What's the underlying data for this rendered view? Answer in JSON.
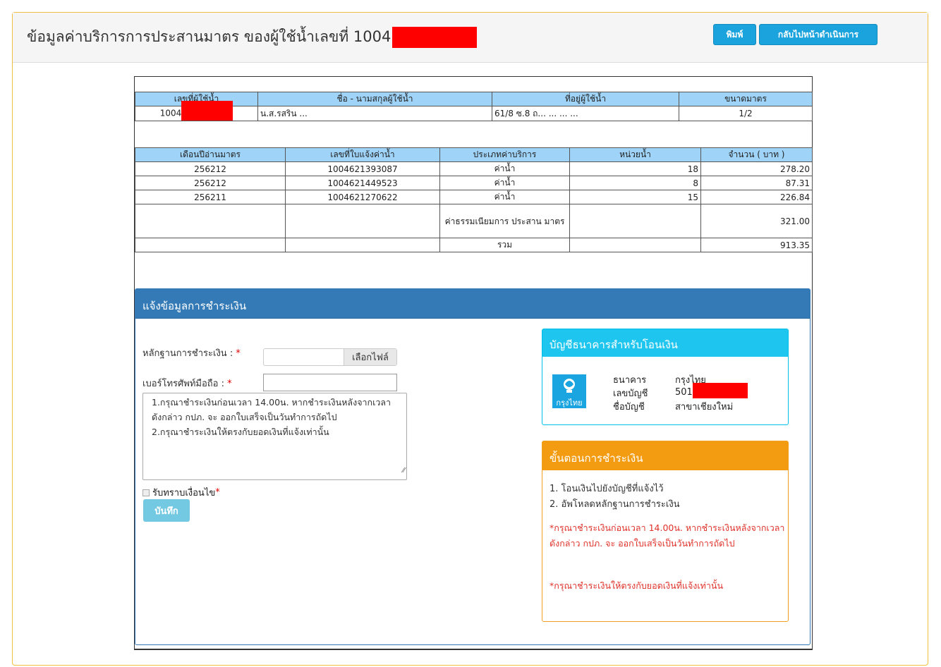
{
  "header": {
    "title": "ข้อมูลค่าบริการการประสานมาตร ของผู้ใช้น้ำเลขที่ 1004",
    "print_label": "พิมพ์",
    "back_label": "กลับไปหน้าดำเนินการ"
  },
  "customer_table": {
    "headers": [
      "เลขที่ผู้ใช้น้ำ",
      "ชื่อ - นามสกุลผู้ใช้น้ำ",
      "ที่อยู่ผู้ใช้น้ำ",
      "ขนาดมาตร"
    ],
    "row": [
      "1004",
      "น.ส.รสริน ...",
      "61/8 ซ.8 ถ... ... ... ...",
      "1/2"
    ]
  },
  "bill_table": {
    "headers": [
      "เดือนปีอ่านมาตร",
      "เลขที่ใบแจ้งค่าน้ำ",
      "ประเภทค่าบริการ",
      "หน่วยน้ำ",
      "จำนวน ( บาท )"
    ],
    "rows": [
      [
        "256212",
        "1004621393087",
        "ค่าน้ำ",
        "18",
        "278.20"
      ],
      [
        "256212",
        "1004621449523",
        "ค่าน้ำ",
        "8",
        "87.31"
      ],
      [
        "256211",
        "1004621270622",
        "ค่าน้ำ",
        "15",
        "226.84"
      ]
    ],
    "fee_label": "ค่าธรรมเนียมการ ประสาน มาตร",
    "fee_amount": "321.00",
    "total_label": "รวม",
    "total_amount": "913.35"
  },
  "payment": {
    "heading": "แจ้งข้อมูลการชำระเงิน",
    "proof_label": "หลักฐานการชำระเงิน : ",
    "file_button": "เลือกไฟล์",
    "phone_label": "เบอร์โทรศัพท์มือถือ : ",
    "required_mark": "*",
    "terms_line1": "1.กรุณาชำระเงินก่อนเวลา 14.00น. หากชำระเงินหลังจากเวลาดังกล่าว กปภ. จะ ออกใบเสร็จเป็นวันทำการถัดไป",
    "terms_line2": "2.กรุณาชำระเงินให้ตรงกับยอดเงินที่แจ้งเท่านั้น",
    "accept_label": "รับทราบเงื่อนไข",
    "save_label": "บันทึก"
  },
  "bank": {
    "heading": "บัญชีธนาคารสำหรับโอนเงิน",
    "logo_text": "กรุงไทย",
    "bank_label": "ธนาคาร",
    "bank_value": "กรุงไทย",
    "account_label": "เลขบัญชี",
    "account_value": "501",
    "name_label": "ชื่อบัญชี",
    "name_value": "สาขาเชียงใหม่"
  },
  "steps": {
    "heading": "ขั้นตอนการชำระเงิน",
    "step1": "1. โอนเงินไปยังบัญชีที่แจ้งไว้",
    "step2": "2. อัพโหลดหลักฐานการชำระเงิน",
    "warn1": "*กรุณาชำระเงินก่อนเวลา 14.00น. หากชำระเงินหลังจากเวลาดังกล่าว กปภ. จะ ออกใบเสร็จเป็นวันทำการถัดไป",
    "warn2": "*กรุณาชำระเงินให้ตรงกับยอดเงินที่แจ้งเท่านั้น"
  },
  "colors": {
    "table_header": "#9fd3f7",
    "panel_primary": "#337ab7",
    "panel_info": "#1ec5ef",
    "panel_warning": "#f39c12",
    "button_blue": "#1aa3dd",
    "redaction": "#ff0000"
  }
}
